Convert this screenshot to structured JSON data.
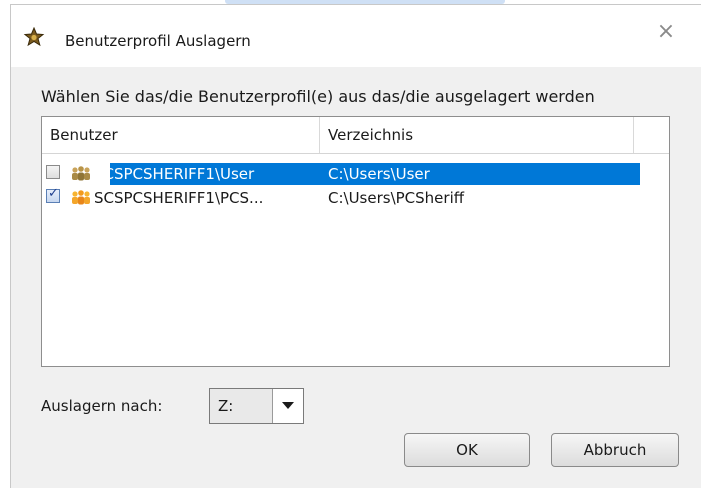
{
  "dialog": {
    "title": "Benutzerprofil Auslagern",
    "close_symbol": "×",
    "app_icon": "sheriff-badge-icon"
  },
  "instruction": "Wählen Sie das/die Benutzerprofil(e) aus das/die ausgelagert werden",
  "table": {
    "columns": [
      "Benutzer",
      "Verzeichnis",
      ""
    ],
    "rows": [
      {
        "checked": false,
        "icon": "user-group-icon",
        "user": "SCSPCSHERIFF1\\User",
        "directory": "C:\\Users\\User",
        "selected": true
      },
      {
        "checked": true,
        "icon": "user-group-icon",
        "user": "SCSPCSHERIFF1\\PCS...",
        "directory": "C:\\Users\\PCSheriff",
        "selected": false
      }
    ]
  },
  "target": {
    "label": "Auslagern nach:",
    "selected_drive": "Z:"
  },
  "buttons": {
    "ok": "OK",
    "cancel": "Abbruch"
  },
  "colors": {
    "selection": "#0078d7",
    "window_bg": "#f0f0f0"
  }
}
